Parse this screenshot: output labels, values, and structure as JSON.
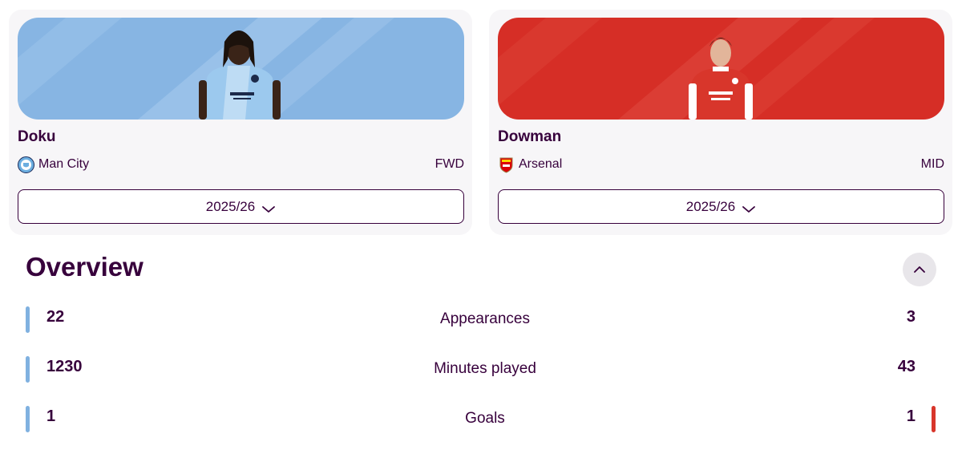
{
  "players": [
    {
      "name": "Doku",
      "club": "Man City",
      "position": "FWD",
      "season": "2025/26",
      "colors": {
        "banner": "#87b5e3",
        "banner_light": "#a7cbee",
        "kit": "#9cc9ee",
        "badge": "#6caee0"
      },
      "banner_image": "player-photo",
      "badge_icon": "man-city-crest-icon"
    },
    {
      "name": "Dowman",
      "club": "Arsenal",
      "position": "MID",
      "season": "2025/26",
      "colors": {
        "banner": "#d62e26",
        "banner_light": "#e04a3f",
        "kit": "#d8362b",
        "badge": "#db0007"
      },
      "banner_image": "player-photo",
      "badge_icon": "arsenal-crest-icon"
    }
  ],
  "overview": {
    "title": "Overview",
    "toggle_icon": "chevron-up-icon",
    "stats": [
      {
        "label": "Appearances",
        "left": "22",
        "right": "3",
        "left_leading": true,
        "right_leading": false
      },
      {
        "label": "Minutes played",
        "left": "1230",
        "right": "43",
        "left_leading": true,
        "right_leading": false
      },
      {
        "label": "Goals",
        "left": "1",
        "right": "1",
        "left_leading": true,
        "right_leading": true
      }
    ]
  }
}
